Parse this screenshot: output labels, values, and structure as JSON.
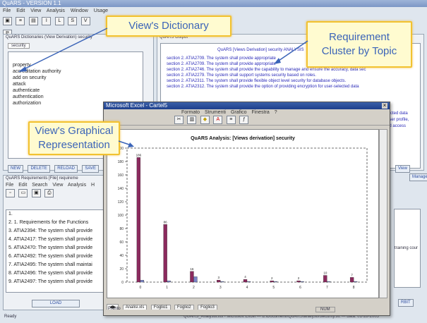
{
  "main_window": {
    "title": "QuARS - VERSION 1.1",
    "menu": [
      "File",
      "Edit",
      "View",
      "Analysis",
      "Window",
      "Usage"
    ],
    "toolbar_letters": [
      "I",
      "L",
      "S",
      "V",
      "P"
    ]
  },
  "dictionary_panel": {
    "header": "QuARS Dictionaries (View Derivation) security",
    "tab": "security",
    "items": [
      "property",
      "accreditation authority",
      "add on security",
      "attack",
      "authenticate",
      "authentication",
      "authorization"
    ],
    "buttons": [
      "NEW",
      "DELETE",
      "RELOAD",
      "SAVE"
    ]
  },
  "output_panel": {
    "header": "QuARS Output",
    "title_line": "QuARS [Views Derivation] security ANALYSIS",
    "lines": [
      "section 2. ATIA2709. The system shall provide appropriate",
      "section 2. ATIA2709. The system shall provide appropriate",
      "section 2. ATIA2746. The system shall provide the capability to manage and ensure the accuracy, data sec",
      "section 2. ATIA2279. The system shall support systems security based on roles.",
      "section 2. ATIA2311. The system shall provide flexible object level security for database objects.",
      "section 2. ATIA2312. The system shall provide the option of providing encryption for user-selected data"
    ],
    "right_fragments": [
      "tected data",
      "user profile,",
      "ad access"
    ]
  },
  "editor_panel": {
    "header": "QuARS Requirements [File] requireme",
    "menu": [
      "File",
      "Edit",
      "Search",
      "View",
      "Analysis",
      "H"
    ],
    "lines": [
      "1.",
      "2. 1. Requirements for the Functions",
      "3. ATIA2394: The system shall provide",
      "4. ATIA2417: The system shall provide",
      "5. ATIA2470: The system shall provide",
      "6. ATIA2492: The system shall provide",
      "7. ATIA2495: The system shall maintai",
      "8. ATIA2496: The system shall provide",
      "9. ATIA2497: The system shall provide"
    ],
    "load_button": "LOAD",
    "status": "Ready"
  },
  "right_partial": {
    "text": "training cour",
    "button": "RBIT",
    "view_label": "View",
    "manage_label": "Manage"
  },
  "excel_window": {
    "title": "Microsoft Excel - Cartel5",
    "menu": [
      "Formato",
      "Strumenti",
      "Grafico",
      "Finestra",
      "?"
    ],
    "sheet_tabs": [
      "Analisi.xls",
      "Foglio1",
      "Foglio2",
      "Foglio3"
    ],
    "status_left": "Pronto",
    "status_right": "NUM"
  },
  "chart_data": {
    "type": "bar",
    "title": "QuARS Analysis: [Views derivation] security",
    "categories": [
      "0",
      "1",
      "2",
      "3",
      "4",
      "5",
      "6",
      "7",
      "8"
    ],
    "series": [
      {
        "name": "",
        "color": "#8b2a5e",
        "values": [
          186,
          86,
          16,
          3,
          4,
          2,
          2,
          10,
          7
        ]
      },
      {
        "name": "",
        "color": "#7b86c8",
        "values": [
          3,
          2,
          8,
          1,
          1,
          1,
          1,
          1,
          1
        ]
      }
    ],
    "data_labels": [
      [
        "186",
        "86",
        "16",
        "3",
        "4",
        "2",
        "2",
        "10",
        "7"
      ],
      [
        "",
        "",
        "",
        "",
        "",
        "",
        "",
        "",
        ""
      ]
    ],
    "ylim": [
      0,
      200
    ],
    "yticks": [
      "200",
      "180",
      "160",
      "140",
      "120",
      "100",
      "80",
      "60",
      "40",
      "20",
      "0"
    ],
    "grid": false
  },
  "callouts": {
    "dictionary": "View's Dictionary",
    "cluster": "Requirement Cluster by Topic",
    "graphical": "View's Graphical Representation"
  },
  "footer_text": "QUARS_Analysis.xls - Microsoft Excel — d:\\Documenti\\QuARS\\analysis\\security.txt — data: 01-28-2005"
}
